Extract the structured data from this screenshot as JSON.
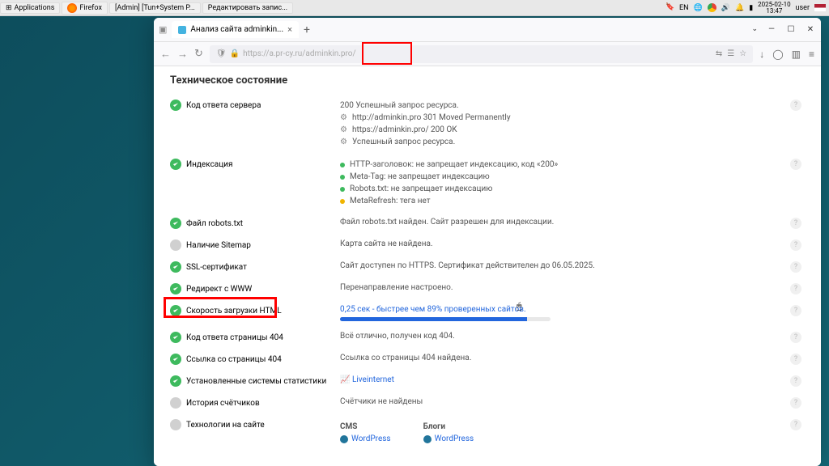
{
  "os": {
    "applications": "Applications",
    "firefox": "Firefox",
    "task1": "[Admin] [Tun+System P...",
    "task2": "Редактировать запис...",
    "lang": "EN",
    "date": "2025-02-10",
    "time": "13:47",
    "user": "user"
  },
  "browser": {
    "tab_title": "Анализ сайта adminkin...",
    "url_host": "https://a.pr-cy.ru",
    "url_path": "/adminkin.pro/",
    "nav_back": "←",
    "nav_fwd": "→",
    "nav_reload": "↻",
    "win_min": "—",
    "win_max": "☐",
    "win_close": "✕"
  },
  "page": {
    "title": "Техническое состояние",
    "rows": {
      "resp_code": {
        "label": "Код ответа сервера",
        "value": "200  Успешный запрос ресурса."
      },
      "resp_hist1": "http://adminkin.pro   301 Moved Permanently",
      "resp_hist2": "https://adminkin.pro/   200 OK",
      "resp_hist3": "Успешный запрос ресурса.",
      "index": {
        "label": "Индексация",
        "l1": "HTTP-заголовок: не запрещает индексацию, код «200»",
        "l2": "Meta-Tag: не запрещает индексацию",
        "l3": "Robots.txt: не запрещает индексацию",
        "l4": "MetaRefresh: тега нет"
      },
      "robots": {
        "label": "Файл robots.txt",
        "value": "Файл robots.txt найден. Сайт разрешен для индексации."
      },
      "sitemap": {
        "label": "Наличие Sitemap",
        "value": "Карта сайта не найдена."
      },
      "ssl": {
        "label": "SSL-сертификат",
        "value": "Сайт доступен по HTTPS. Сертификат действителен до 06.05.2025."
      },
      "www": {
        "label": "Редирект с WWW",
        "value": "Перенаправление настроено."
      },
      "speed": {
        "label": "Скорость загрузки HTML",
        "value": "0,25 сек - быстрее чем 89% проверенных сайтов.",
        "percent": 89
      },
      "c404": {
        "label": "Код ответа страницы 404",
        "value": "Всё отлично, получен код 404."
      },
      "l404": {
        "label": "Ссылка со страницы 404",
        "value": "Ссылка со страницы 404 найдена."
      },
      "stats": {
        "label": "Установленные системы статистики",
        "value": "Liveinternet"
      },
      "counters": {
        "label": "История счётчиков",
        "value": "Счётчики не найдены"
      },
      "tech": {
        "label": "Технологии на сайте",
        "cms": "CMS",
        "blogs": "Блоги",
        "wp": "WordPress"
      }
    }
  }
}
